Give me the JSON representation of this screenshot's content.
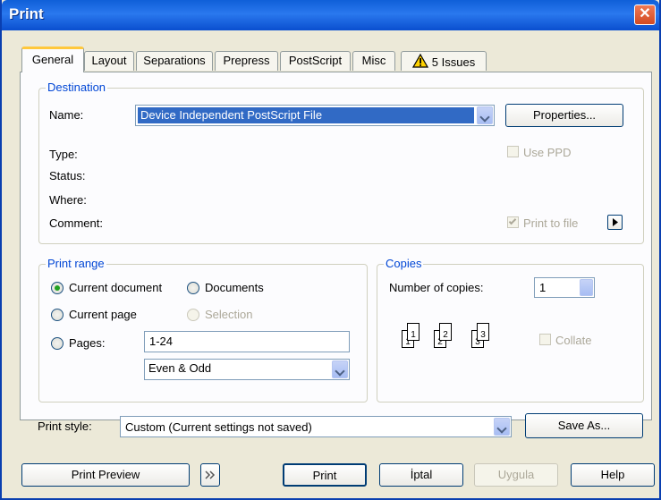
{
  "window": {
    "title": "Print",
    "close_glyph": "✕"
  },
  "tabs": [
    {
      "label": "General",
      "active": true
    },
    {
      "label": "Layout"
    },
    {
      "label": "Separations"
    },
    {
      "label": "Prepress"
    },
    {
      "label": "PostScript"
    },
    {
      "label": "Misc"
    },
    {
      "label": "5 Issues",
      "icon": "warning-icon"
    }
  ],
  "destination": {
    "group_title": "Destination",
    "name_label": "Name:",
    "name_value": "Device Independent PostScript File",
    "properties_button": "Properties...",
    "type_label": "Type:",
    "status_label": "Status:",
    "where_label": "Where:",
    "comment_label": "Comment:",
    "use_ppd_label": "Use PPD",
    "print_to_file_label": "Print to file",
    "print_to_file_checked": true
  },
  "print_range": {
    "group_title": "Print range",
    "current_document": "Current document",
    "documents": "Documents",
    "current_page": "Current page",
    "selection": "Selection",
    "pages_label": "Pages:",
    "pages_value": "1-24",
    "page_set_value": "Even & Odd",
    "selected": "current_document"
  },
  "copies": {
    "group_title": "Copies",
    "number_label": "Number of copies:",
    "number_value": "1",
    "collate_label": "Collate",
    "collate_pages": [
      "1",
      "1",
      "2",
      "2",
      "3",
      "3"
    ]
  },
  "print_style": {
    "label": "Print style:",
    "value": "Custom (Current settings not saved)",
    "save_as_button": "Save As..."
  },
  "footer": {
    "print_preview": "Print Preview",
    "print": "Print",
    "cancel": "İptal",
    "apply": "Uygula",
    "help": "Help"
  },
  "colors": {
    "titlebar": "#0f5fd8",
    "group_title": "#0046d5",
    "selection_highlight": "#316ac5",
    "dialog_bg": "#ece9d8"
  }
}
